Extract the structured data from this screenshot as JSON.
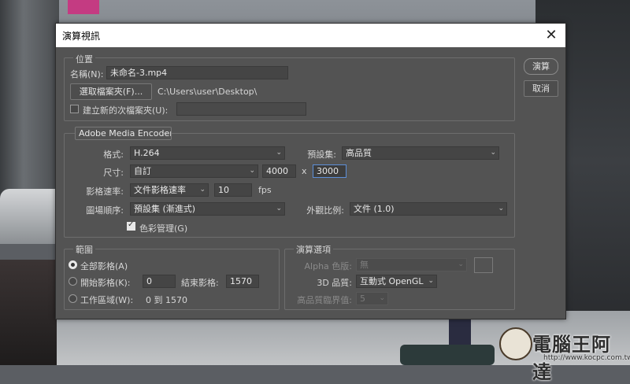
{
  "dialog": {
    "title": "演算視訊",
    "close_icon": "close-icon",
    "buttons": {
      "render": "演算",
      "cancel": "取消"
    }
  },
  "location": {
    "group_label": "位置",
    "name_label": "名稱(N):",
    "name_value": "未命名-3.mp4",
    "select_folder_button": "選取檔案夾(F)...",
    "folder_path": "C:\\Users\\user\\Desktop\\",
    "create_subfolder_label": "建立新的次檔案夾(U):",
    "create_subfolder_checked": false,
    "subfolder_value": ""
  },
  "encoder": {
    "selected": "Adobe Media Encoder",
    "format_label": "格式:",
    "format_value": "H.264",
    "preset_label": "預設集:",
    "preset_value": "高品質",
    "size_label": "尺寸:",
    "size_mode": "自訂",
    "width": "4000",
    "x_sep": "x",
    "height": "3000",
    "frame_rate_label": "影格速率:",
    "frame_rate_mode": "文件影格速率",
    "frame_rate_value": "10",
    "fps_unit": "fps",
    "field_order_label": "圖場順序:",
    "field_order_value": "預設集 (漸進式)",
    "aspect_label": "外觀比例:",
    "aspect_value": "文件 (1.0)",
    "color_manage_label": "色彩管理(G)",
    "color_manage_checked": true
  },
  "range": {
    "group_label": "範圍",
    "all_frames_label": "全部影格(A)",
    "start_label": "開始影格(K):",
    "start_value": "0",
    "end_label": "結束影格:",
    "end_value": "1570",
    "work_area_label": "工作區域(W):",
    "work_area_value": "0 到 1570",
    "selected": "all_frames"
  },
  "render_options": {
    "group_label": "演算選項",
    "alpha_label": "Alpha 色版:",
    "alpha_value": "無",
    "quality_3d_label": "3D 品質:",
    "quality_3d_value": "互動式 OpenGL",
    "hq_threshold_label": "高品質臨界值:",
    "hq_threshold_value": "5"
  },
  "watermark": {
    "text": "電腦王阿達",
    "url": "http://www.kocpc.com.tw"
  }
}
